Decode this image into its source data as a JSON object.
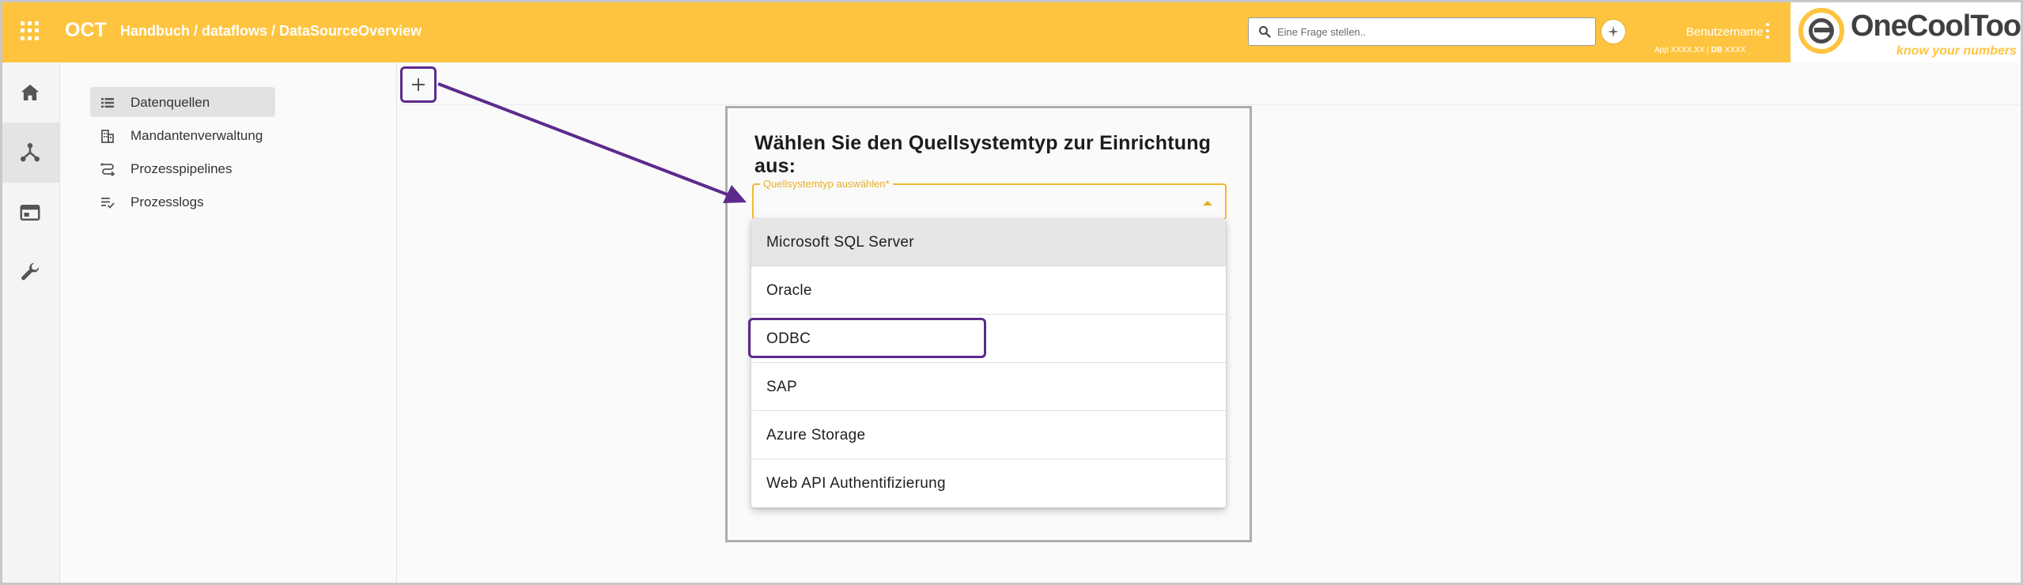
{
  "header": {
    "app_name": "OCT",
    "breadcrumb": "Handbuch / dataflows / DataSourceOverview",
    "search_placeholder": "Eine Frage stellen..",
    "username": "Benutzername",
    "version_app_label": "App",
    "version_app_value": "XXXX.XX",
    "version_sep": " | ",
    "version_db_label": "DB",
    "version_db_value": "XXXX",
    "logo_name": "OneCoolTool",
    "logo_tagline": "know your numbers",
    "accent_color": "#fec43f"
  },
  "rail": {
    "items": [
      {
        "icon": "home-icon",
        "active": false
      },
      {
        "icon": "dataflow-icon",
        "active": true
      },
      {
        "icon": "window-icon",
        "active": false
      },
      {
        "icon": "wrench-icon",
        "active": false
      }
    ]
  },
  "nav": {
    "items": [
      {
        "label": "Datenquellen",
        "icon": "list-icon",
        "active": true
      },
      {
        "label": "Mandantenverwaltung",
        "icon": "building-icon",
        "active": false
      },
      {
        "label": "Prozesspipelines",
        "icon": "pipeline-icon",
        "active": false
      },
      {
        "label": "Prozesslogs",
        "icon": "checklist-icon",
        "active": false
      }
    ]
  },
  "dialog": {
    "title": "Wählen Sie den Quellsystemtyp zur Einrichtung aus:",
    "select_label": "Quellsystemtyp auswählen*",
    "options": [
      "Microsoft SQL Server",
      "Oracle",
      "ODBC",
      "SAP",
      "Azure Storage",
      "Web API Authentifizierung"
    ]
  },
  "annotation_color": "#5c2a8c"
}
